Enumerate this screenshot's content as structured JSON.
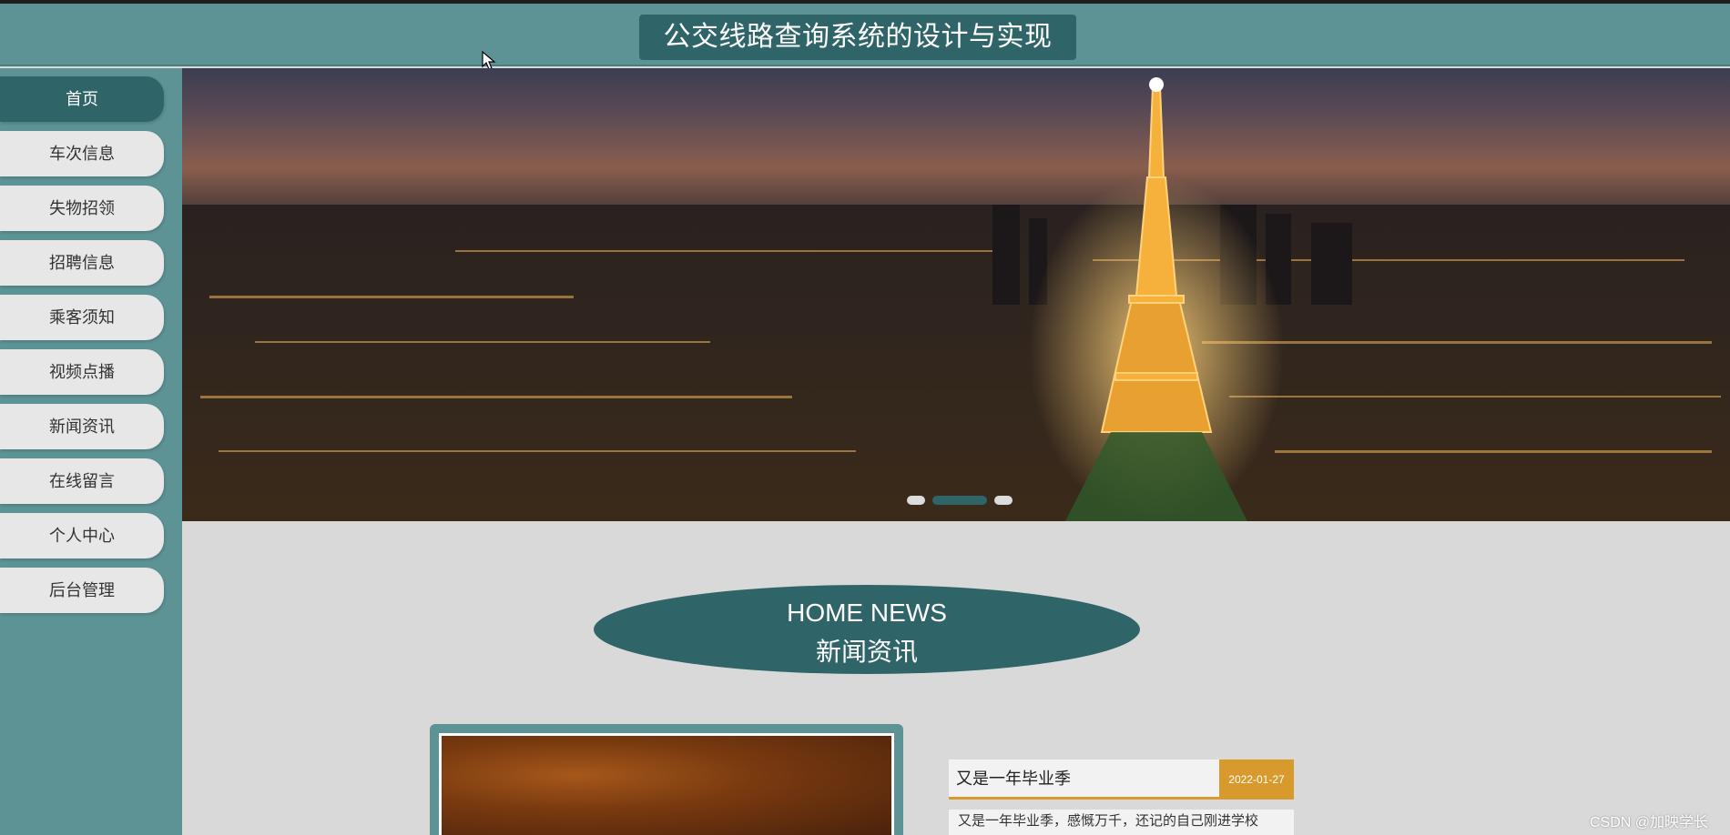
{
  "header": {
    "title": "公交线路查询系统的设计与实现"
  },
  "sidebar": {
    "items": [
      {
        "label": "首页",
        "active": true
      },
      {
        "label": "车次信息"
      },
      {
        "label": "失物招领"
      },
      {
        "label": "招聘信息"
      },
      {
        "label": "乘客须知"
      },
      {
        "label": "视频点播"
      },
      {
        "label": "新闻资讯"
      },
      {
        "label": "在线留言"
      },
      {
        "label": "个人中心"
      },
      {
        "label": "后台管理"
      }
    ]
  },
  "banner": {
    "image": "paris-night-eiffel-tower",
    "carousel": {
      "count": 3,
      "active_index": 1
    }
  },
  "news_section": {
    "title_en": "HOME NEWS",
    "title_cn": "新闻资讯",
    "featured_image": "news-cover-image",
    "item": {
      "title": "又是一年毕业季",
      "date": "2022-01-27",
      "excerpt": "又是一年毕业季，感慨万千，还记的自己刚进学校"
    }
  },
  "watermark": "CSDN @加映学长",
  "colors": {
    "header_bg": "#5e9396",
    "accent_dark": "#2f6568",
    "date_badge": "#d89a2c",
    "page_bg": "#d9d9d9"
  }
}
